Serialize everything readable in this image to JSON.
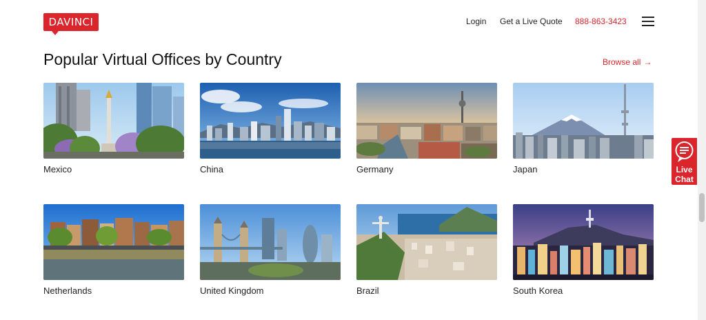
{
  "header": {
    "logo_text": "DAVINCI",
    "nav": {
      "login": "Login",
      "quote": "Get a Live Quote",
      "phone": "888-863-3423"
    }
  },
  "section": {
    "title": "Popular Virtual Offices by Country",
    "browse_all": "Browse all",
    "browse_arrow": "→",
    "countries": [
      {
        "name": "Mexico"
      },
      {
        "name": "China"
      },
      {
        "name": "Germany"
      },
      {
        "name": "Japan"
      },
      {
        "name": "Netherlands"
      },
      {
        "name": "United Kingdom"
      },
      {
        "name": "Brazil"
      },
      {
        "name": "South Korea"
      }
    ]
  },
  "live_chat": {
    "line1": "Live",
    "line2": "Chat"
  },
  "colors": {
    "brand_red": "#d9252b"
  }
}
